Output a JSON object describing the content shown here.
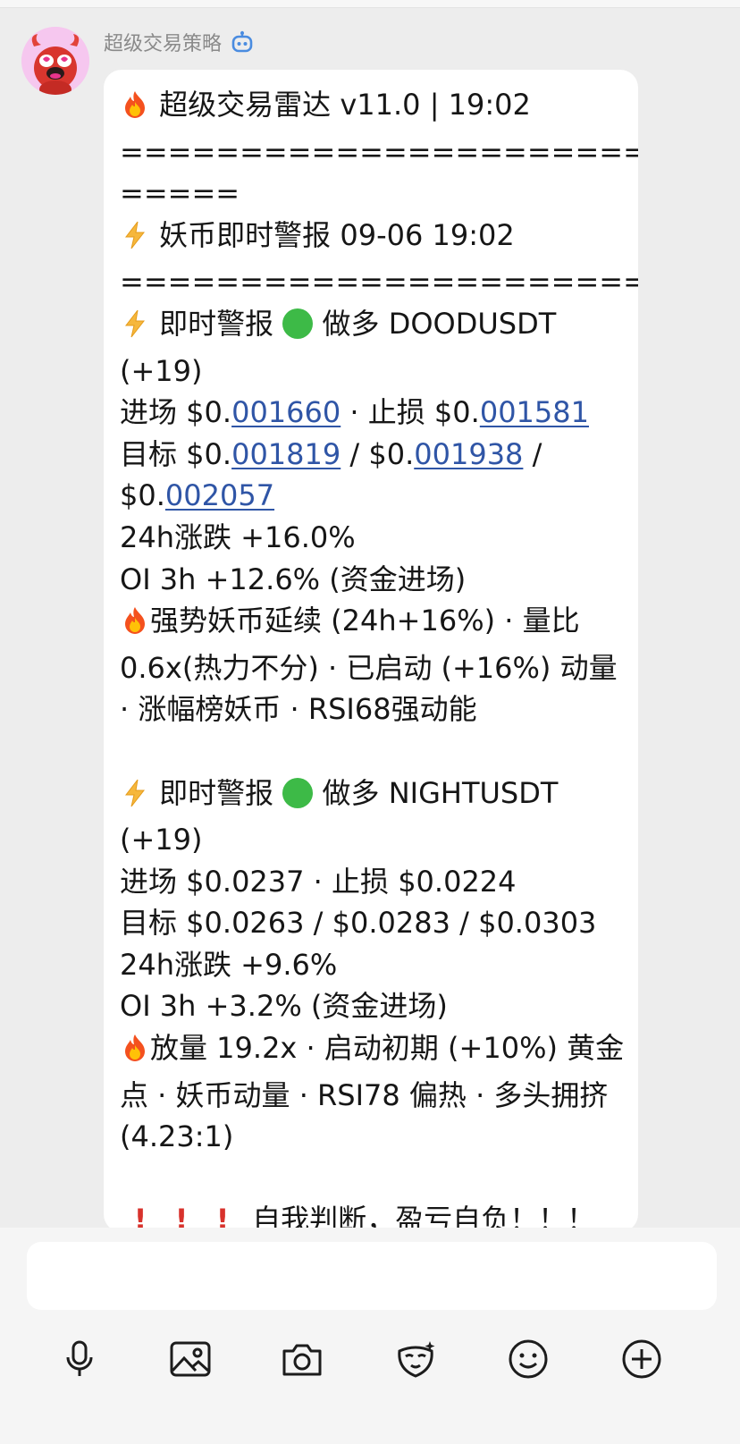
{
  "sender": {
    "name": "超级交易策略"
  },
  "message": {
    "title": "超级交易雷达 v11.0 | 19:02",
    "sep1a": "==========================",
    "sep1b": "=====",
    "subtitle": "妖币即时警报 09-06 19:02",
    "sep2": "=========================",
    "alert1": {
      "prefix": "即时警报",
      "direction": "做多 DOODUSDT",
      "score": "(+19)",
      "entry_label": "进场 $0.",
      "entry_link": "001660",
      "stop_label": " · 止损 $0.",
      "stop_link": "001581",
      "target_label": "目标 $0.",
      "target1_link": "001819",
      "target_mid": " / $0.",
      "target2_link": "001938",
      "target_end": " /",
      "target3_label": "$0.",
      "target3_link": "002057",
      "change24h": "24h涨跌 +16.0%",
      "oi": "OI 3h +12.6% (资金进场)",
      "note": "强势妖币延续 (24h+16%) · 量比 0.6x(热力不分) · 已启动 (+16%) 动量 · 涨幅榜妖币 · RSI68强动能"
    },
    "alert2": {
      "prefix": "即时警报",
      "direction": "做多 NIGHTUSDT",
      "score": "(+19)",
      "entry": "进场 $0.0237 · 止损 $0.0224",
      "targets": "目标 $0.0263 / $0.0283 / $0.0303",
      "change24h": "24h涨跌 +9.6%",
      "oi": "OI 3h +3.2% (资金进场)",
      "note": "放量 19.2x · 启动初期 (+10%) 黄金点 · 妖币动量 · RSI78 偏热 · 多头拥挤 (4.23:1)"
    },
    "disclaimer": "自我判断，盈亏自负！！！"
  },
  "composer": {
    "placeholder": "",
    "tools": [
      "mic-icon",
      "image-icon",
      "camera-icon",
      "sticker-icon",
      "emoji-icon",
      "plus-icon"
    ]
  },
  "colors": {
    "link": "#2f55a6",
    "green_dot": "#3dba47",
    "exclamation": "#d8322c",
    "bg": "#ededed"
  }
}
